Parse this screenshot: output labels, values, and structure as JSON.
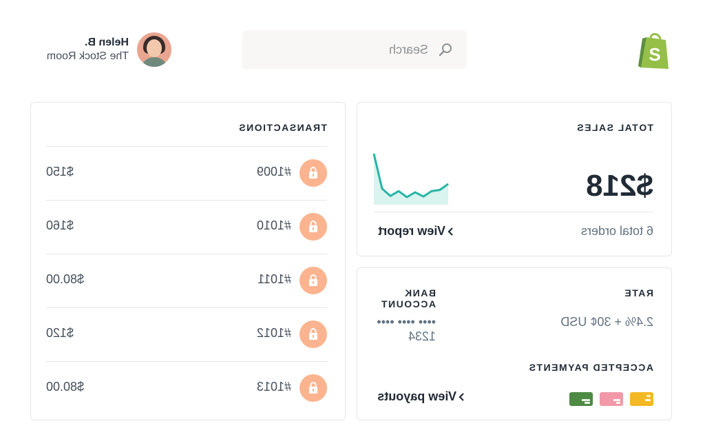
{
  "header": {
    "search_placeholder": "Search",
    "user": {
      "name": "Helen B.",
      "store": "The Stock Room"
    }
  },
  "colors": {
    "accent_green": "#95bf47",
    "lock_badge": "#fbb48f",
    "sparkline": "#26b5a5",
    "sparkline_fill": "#d9f3ef",
    "card_green": "#4d8a43",
    "card_pink": "#f199a8",
    "card_yellow": "#f3b824"
  },
  "total_sales": {
    "title": "TOTAL SALES",
    "value": "$218",
    "orders": "6 total orders",
    "link": "View report",
    "trend": [
      80,
      22,
      10,
      18,
      8,
      16,
      9,
      18,
      20,
      30
    ]
  },
  "account": {
    "rate_title": "RATE",
    "rate_value": "2.4% + 30¢ USD",
    "bank_title": "BANK ACCOUNT",
    "bank_value": "•••• •••• •••• 1234",
    "payments_title": "ACCEPTED PAYMENTS",
    "payment_cards": [
      "card-yellow-icon",
      "card-pink-icon",
      "card-green-icon"
    ],
    "payouts_link": "View payouts"
  },
  "transactions": {
    "title": "TRANSACTIONS",
    "rows": [
      {
        "id": "#1009",
        "amount": "$150"
      },
      {
        "id": "#1010",
        "amount": "$160"
      },
      {
        "id": "#1011",
        "amount": "$80.00"
      },
      {
        "id": "#1012",
        "amount": "$120"
      },
      {
        "id": "#1013",
        "amount": "$80.00"
      }
    ]
  }
}
